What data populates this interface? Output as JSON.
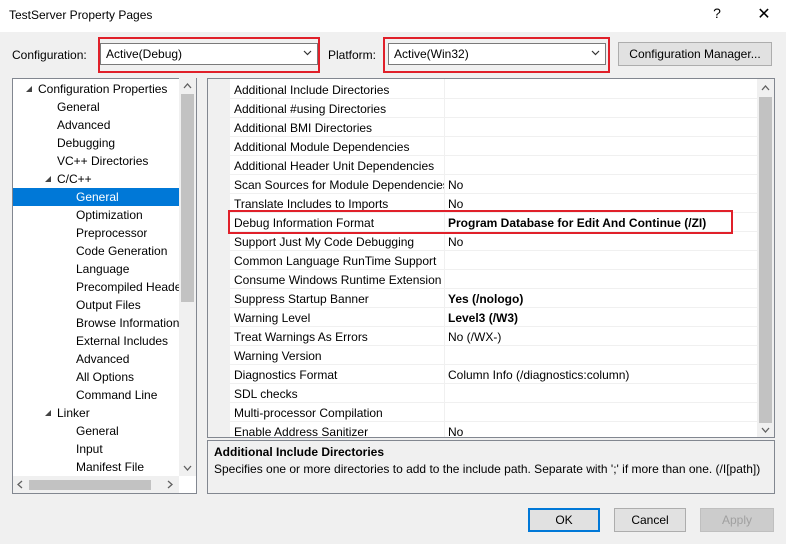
{
  "window": {
    "title": "TestServer Property Pages",
    "help_glyph": "?",
    "close_glyph": "✕"
  },
  "toolbar": {
    "configuration_label": "Configuration:",
    "configuration_value": "Active(Debug)",
    "platform_label": "Platform:",
    "platform_value": "Active(Win32)",
    "config_manager_label": "Configuration Manager..."
  },
  "tree": {
    "items": [
      {
        "label": "Configuration Properties",
        "level": 0,
        "expanded": true
      },
      {
        "label": "General",
        "level": 1
      },
      {
        "label": "Advanced",
        "level": 1
      },
      {
        "label": "Debugging",
        "level": 1
      },
      {
        "label": "VC++ Directories",
        "level": 1
      },
      {
        "label": "C/C++",
        "level": 1,
        "expanded": true
      },
      {
        "label": "General",
        "level": 2,
        "selected": true
      },
      {
        "label": "Optimization",
        "level": 2
      },
      {
        "label": "Preprocessor",
        "level": 2
      },
      {
        "label": "Code Generation",
        "level": 2
      },
      {
        "label": "Language",
        "level": 2
      },
      {
        "label": "Precompiled Headers",
        "level": 2
      },
      {
        "label": "Output Files",
        "level": 2
      },
      {
        "label": "Browse Information",
        "level": 2
      },
      {
        "label": "External Includes",
        "level": 2
      },
      {
        "label": "Advanced",
        "level": 2
      },
      {
        "label": "All Options",
        "level": 2
      },
      {
        "label": "Command Line",
        "level": 2
      },
      {
        "label": "Linker",
        "level": 1,
        "expanded": true
      },
      {
        "label": "General",
        "level": 2
      },
      {
        "label": "Input",
        "level": 2
      },
      {
        "label": "Manifest File",
        "level": 2
      }
    ]
  },
  "properties": {
    "rows": [
      {
        "name": "Additional Include Directories",
        "value": "",
        "bold": false
      },
      {
        "name": "Additional #using Directories",
        "value": "",
        "bold": false
      },
      {
        "name": "Additional BMI Directories",
        "value": "",
        "bold": false
      },
      {
        "name": "Additional Module Dependencies",
        "value": "",
        "bold": false
      },
      {
        "name": "Additional Header Unit Dependencies",
        "value": "",
        "bold": false
      },
      {
        "name": "Scan Sources for Module Dependencies",
        "value": "No",
        "bold": false
      },
      {
        "name": "Translate Includes to Imports",
        "value": "No",
        "bold": false
      },
      {
        "name": "Debug Information Format",
        "value": "Program Database for Edit And Continue (/ZI)",
        "bold": true,
        "highlight": true
      },
      {
        "name": "Support Just My Code Debugging",
        "value": "No",
        "bold": false
      },
      {
        "name": "Common Language RunTime Support",
        "value": "",
        "bold": false
      },
      {
        "name": "Consume Windows Runtime Extension",
        "value": "",
        "bold": false
      },
      {
        "name": "Suppress Startup Banner",
        "value": "Yes (/nologo)",
        "bold": true
      },
      {
        "name": "Warning Level",
        "value": "Level3 (/W3)",
        "bold": true
      },
      {
        "name": "Treat Warnings As Errors",
        "value": "No (/WX-)",
        "bold": false
      },
      {
        "name": "Warning Version",
        "value": "",
        "bold": false
      },
      {
        "name": "Diagnostics Format",
        "value": "Column Info (/diagnostics:column)",
        "bold": false
      },
      {
        "name": "SDL checks",
        "value": "",
        "bold": false
      },
      {
        "name": "Multi-processor Compilation",
        "value": "",
        "bold": false
      },
      {
        "name": "Enable Address Sanitizer",
        "value": "No",
        "bold": false
      }
    ]
  },
  "description": {
    "title": "Additional Include Directories",
    "text": "Specifies one or more directories to add to the include path. Separate with ';' if more than one. (/I[path])"
  },
  "buttons": {
    "ok": "OK",
    "cancel": "Cancel",
    "apply": "Apply"
  },
  "colors": {
    "selection": "#0078d7",
    "highlight_box": "#e0202a"
  }
}
